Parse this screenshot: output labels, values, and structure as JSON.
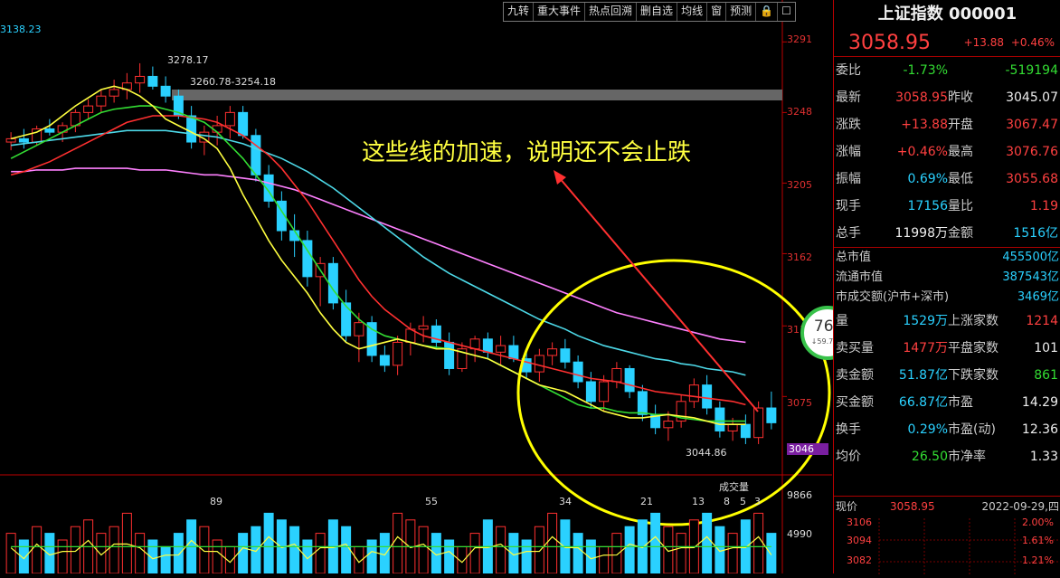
{
  "toolbar": [
    "九转",
    "重大事件",
    "热点回溯",
    "删自选",
    "均线",
    "窗",
    "预测",
    "🔒",
    "☐"
  ],
  "chart": {
    "top_left_price": "3138.23",
    "y_ticks": [
      "3291",
      "3248",
      "3205",
      "3162",
      "3118",
      "3075",
      "3046"
    ],
    "current_price_tag": "3046",
    "high_label": "3278.17",
    "range_label": "3260.78-3254.18",
    "low_label": "3044.86",
    "annotation": "这些线的加速，说明还不会止跌",
    "volume_title": "成交量",
    "volume_ticks": [
      "9866",
      "4990"
    ],
    "volume_markers": [
      "89",
      "55",
      "34",
      "21",
      "13",
      "8",
      "5",
      "3"
    ],
    "colors": {
      "up": "#ff3030",
      "down": "#2ad1ff",
      "ma5": "#ffff40",
      "ma10": "#33dd33",
      "ma20": "#ff3030",
      "ma60": "#4dd9e8",
      "ma120": "#ff80ff",
      "circle": "#ffff00",
      "arrow": "#ff3030"
    }
  },
  "gauge": {
    "percent": "76",
    "percent_unit": "%",
    "speed": "↓59.7K/s"
  },
  "info": {
    "title": "上证指数 000001",
    "price": "3058.95",
    "change": "+13.88",
    "change_pct": "+0.46%",
    "rows": [
      {
        "k": "委比",
        "v": "-1.73%",
        "vc": "green",
        "k2": "",
        "v2": "-519194",
        "v2c": "green"
      },
      {
        "k": "最新",
        "v": "3058.95",
        "vc": "red",
        "k2": "昨收",
        "v2": "3045.07",
        "v2c": "white"
      },
      {
        "k": "涨跌",
        "v": "+13.88",
        "vc": "red",
        "k2": "开盘",
        "v2": "3067.47",
        "v2c": "red"
      },
      {
        "k": "涨幅",
        "v": "+0.46%",
        "vc": "red",
        "k2": "最高",
        "v2": "3076.76",
        "v2c": "red"
      },
      {
        "k": "振幅",
        "v": "0.69%",
        "vc": "cyan",
        "k2": "最低",
        "v2": "3055.68",
        "v2c": "red"
      },
      {
        "k": "现手",
        "v": "17156",
        "vc": "cyan",
        "k2": "量比",
        "v2": "1.19",
        "v2c": "red"
      },
      {
        "k": "总手",
        "v": "11998万",
        "vc": "white",
        "k2": "金额",
        "v2": "1516亿",
        "v2c": "cyan"
      }
    ],
    "cap_rows": [
      {
        "k": "总市值",
        "v": "455500亿"
      },
      {
        "k": "流通市值",
        "v": "387543亿"
      },
      {
        "k": "市成交额(沪市+深市)",
        "v": "3469亿"
      }
    ],
    "rows2": [
      {
        "k": "量",
        "v": "1529万",
        "vc": "cyan",
        "k2": "上涨家数",
        "v2": "1214",
        "v2c": "red"
      },
      {
        "k": "卖买量",
        "v": "1477万",
        "vc": "red",
        "k2": "平盘家数",
        "v2": "101",
        "v2c": "white"
      },
      {
        "k": "卖金额",
        "v": "51.87亿",
        "vc": "cyan",
        "k2": "下跌家数",
        "v2": "861",
        "v2c": "green"
      },
      {
        "k": "买金额",
        "v": "66.87亿",
        "vc": "cyan",
        "k2": "市盈",
        "v2": "14.29",
        "v2c": "white"
      },
      {
        "k": "换手",
        "v": "0.29%",
        "vc": "cyan",
        "k2": "市盈(动)",
        "v2": "12.36",
        "v2c": "white"
      },
      {
        "k": "均价",
        "v": "26.50",
        "vc": "green",
        "k2": "市净率",
        "v2": "1.33",
        "v2c": "white"
      }
    ],
    "mini": {
      "label": "现价",
      "price": "3058.95",
      "date": "2022-09-29,四",
      "y": [
        "3106",
        "3094",
        "3082"
      ],
      "pct": [
        "2.00%",
        "1.61%",
        "1.21%"
      ]
    }
  },
  "chart_data": {
    "type": "candlestick",
    "ylim": [
      3030,
      3300
    ],
    "ohlc": [
      [
        3230,
        3236,
        3225,
        3232
      ],
      [
        3232,
        3238,
        3226,
        3230
      ],
      [
        3230,
        3240,
        3228,
        3238
      ],
      [
        3238,
        3244,
        3234,
        3236
      ],
      [
        3236,
        3242,
        3230,
        3240
      ],
      [
        3240,
        3250,
        3236,
        3248
      ],
      [
        3248,
        3256,
        3244,
        3252
      ],
      [
        3252,
        3262,
        3248,
        3258
      ],
      [
        3258,
        3268,
        3254,
        3262
      ],
      [
        3262,
        3272,
        3256,
        3266
      ],
      [
        3266,
        3278,
        3260,
        3270
      ],
      [
        3270,
        3276,
        3262,
        3264
      ],
      [
        3264,
        3270,
        3254,
        3258
      ],
      [
        3258,
        3262,
        3244,
        3246
      ],
      [
        3246,
        3252,
        3226,
        3230
      ],
      [
        3230,
        3240,
        3222,
        3236
      ],
      [
        3236,
        3246,
        3228,
        3240
      ],
      [
        3240,
        3252,
        3232,
        3248
      ],
      [
        3248,
        3252,
        3232,
        3234
      ],
      [
        3234,
        3238,
        3206,
        3210
      ],
      [
        3210,
        3216,
        3190,
        3194
      ],
      [
        3194,
        3200,
        3170,
        3176
      ],
      [
        3176,
        3186,
        3160,
        3170
      ],
      [
        3170,
        3176,
        3142,
        3148
      ],
      [
        3148,
        3160,
        3130,
        3156
      ],
      [
        3156,
        3160,
        3128,
        3132
      ],
      [
        3132,
        3140,
        3108,
        3112
      ],
      [
        3112,
        3126,
        3096,
        3120
      ],
      [
        3120,
        3124,
        3096,
        3100
      ],
      [
        3100,
        3106,
        3090,
        3094
      ],
      [
        3094,
        3112,
        3088,
        3108
      ],
      [
        3108,
        3120,
        3100,
        3116
      ],
      [
        3116,
        3124,
        3108,
        3118
      ],
      [
        3118,
        3122,
        3104,
        3108
      ],
      [
        3108,
        3114,
        3088,
        3092
      ],
      [
        3092,
        3108,
        3090,
        3104
      ],
      [
        3104,
        3112,
        3096,
        3110
      ],
      [
        3110,
        3114,
        3098,
        3102
      ],
      [
        3102,
        3112,
        3094,
        3106
      ],
      [
        3106,
        3112,
        3096,
        3098
      ],
      [
        3098,
        3104,
        3086,
        3090
      ],
      [
        3090,
        3104,
        3084,
        3100
      ],
      [
        3100,
        3108,
        3094,
        3104
      ],
      [
        3104,
        3110,
        3092,
        3096
      ],
      [
        3096,
        3100,
        3080,
        3084
      ],
      [
        3084,
        3090,
        3068,
        3072
      ],
      [
        3072,
        3088,
        3066,
        3084
      ],
      [
        3084,
        3096,
        3080,
        3092
      ],
      [
        3092,
        3094,
        3074,
        3078
      ],
      [
        3078,
        3082,
        3060,
        3064
      ],
      [
        3064,
        3070,
        3052,
        3056
      ],
      [
        3056,
        3066,
        3048,
        3060
      ],
      [
        3060,
        3076,
        3056,
        3072
      ],
      [
        3072,
        3086,
        3068,
        3082
      ],
      [
        3082,
        3088,
        3064,
        3068
      ],
      [
        3068,
        3072,
        3050,
        3054
      ],
      [
        3054,
        3062,
        3048,
        3058
      ],
      [
        3058,
        3064,
        3046,
        3050
      ],
      [
        3050,
        3072,
        3046,
        3068
      ],
      [
        3068,
        3078,
        3055,
        3059
      ]
    ],
    "ma5": [
      3232,
      3234,
      3236,
      3240,
      3246,
      3252,
      3257,
      3262,
      3264,
      3262,
      3258,
      3252,
      3244,
      3240,
      3236,
      3232,
      3226,
      3214,
      3198,
      3184,
      3170,
      3158,
      3148,
      3138,
      3126,
      3116,
      3108,
      3104,
      3106,
      3108,
      3110,
      3108,
      3106,
      3104,
      3104,
      3102,
      3100,
      3098,
      3094,
      3090,
      3086,
      3082,
      3080,
      3078,
      3074,
      3070,
      3066,
      3064,
      3062,
      3062,
      3063,
      3064,
      3063,
      3062,
      3060,
      3058,
      3058,
      3058
    ],
    "ma10": [
      3220,
      3224,
      3228,
      3232,
      3236,
      3240,
      3244,
      3248,
      3250,
      3251,
      3252,
      3252,
      3250,
      3248,
      3245,
      3242,
      3236,
      3228,
      3220,
      3210,
      3200,
      3188,
      3176,
      3164,
      3152,
      3140,
      3130,
      3122,
      3116,
      3112,
      3110,
      3108,
      3106,
      3105,
      3104,
      3102,
      3100,
      3098,
      3094,
      3090,
      3086,
      3082,
      3078,
      3074,
      3070,
      3068,
      3068,
      3066,
      3065,
      3065,
      3064,
      3064,
      3062,
      3061,
      3060,
      3060,
      3060,
      3060
    ],
    "ma20": [
      3210,
      3212,
      3215,
      3218,
      3222,
      3226,
      3230,
      3234,
      3238,
      3242,
      3244,
      3246,
      3246,
      3246,
      3245,
      3244,
      3242,
      3238,
      3234,
      3228,
      3222,
      3214,
      3204,
      3194,
      3182,
      3170,
      3158,
      3146,
      3136,
      3128,
      3122,
      3116,
      3112,
      3110,
      3108,
      3106,
      3104,
      3102,
      3100,
      3098,
      3096,
      3094,
      3092,
      3090,
      3088,
      3086,
      3085,
      3084,
      3082,
      3080,
      3078,
      3077,
      3076,
      3075,
      3074,
      3073,
      3072,
      3070
    ],
    "ma60": [
      3228,
      3229,
      3230,
      3231,
      3232,
      3233,
      3234,
      3235,
      3236,
      3237,
      3237,
      3237,
      3237,
      3236,
      3235,
      3234,
      3233,
      3231,
      3229,
      3226,
      3223,
      3220,
      3216,
      3212,
      3207,
      3202,
      3196,
      3190,
      3184,
      3178,
      3172,
      3166,
      3160,
      3155,
      3150,
      3146,
      3142,
      3138,
      3134,
      3130,
      3126,
      3122,
      3119,
      3116,
      3112,
      3109,
      3106,
      3104,
      3102,
      3100,
      3098,
      3097,
      3095,
      3094,
      3092,
      3091,
      3090,
      3088
    ],
    "ma120": [
      3212,
      3212,
      3213,
      3213,
      3213,
      3214,
      3214,
      3214,
      3214,
      3214,
      3213,
      3213,
      3213,
      3212,
      3211,
      3210,
      3210,
      3209,
      3208,
      3207,
      3205,
      3203,
      3201,
      3198,
      3195,
      3192,
      3189,
      3186,
      3183,
      3180,
      3177,
      3174,
      3171,
      3168,
      3165,
      3162,
      3159,
      3156,
      3153,
      3150,
      3147,
      3144,
      3141,
      3138,
      3135,
      3132,
      3129,
      3126,
      3124,
      3122,
      3120,
      3118,
      3116,
      3114,
      3112,
      3110,
      3109,
      3108
    ],
    "volume": [
      6,
      5,
      7,
      6,
      5,
      7,
      8,
      6,
      7,
      9,
      6,
      5,
      4,
      6,
      8,
      7,
      5,
      4,
      6,
      7,
      9,
      8,
      7,
      5,
      6,
      8,
      7,
      4,
      5,
      6,
      9,
      8,
      7,
      6,
      5,
      4,
      6,
      8,
      7,
      6,
      5,
      7,
      9,
      8,
      6,
      5,
      4,
      6,
      7,
      8,
      9,
      7,
      6,
      8,
      9,
      7,
      6,
      8,
      9,
      6
    ]
  }
}
